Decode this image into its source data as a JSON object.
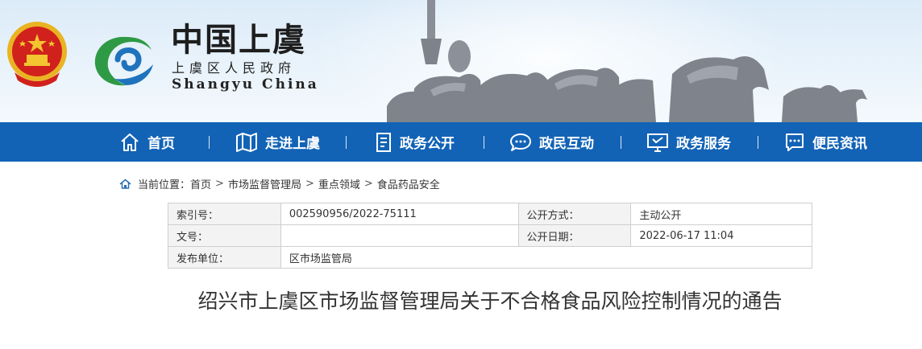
{
  "header": {
    "site_title": "中国上虞",
    "site_subtitle": "上虞区人民政府",
    "site_en": "Shangyu China",
    "brand_blue": "#1263b6",
    "brand_green": "#2f9a45"
  },
  "nav": {
    "items": [
      {
        "label": "首页",
        "icon": "home-icon"
      },
      {
        "label": "走进上虞",
        "icon": "map-icon"
      },
      {
        "label": "政务公开",
        "icon": "document-icon"
      },
      {
        "label": "政民互动",
        "icon": "chat-icon"
      },
      {
        "label": "政务服务",
        "icon": "monitor-icon"
      },
      {
        "label": "便民资讯",
        "icon": "message-icon"
      }
    ]
  },
  "breadcrumb": {
    "prefix": "当前位置：",
    "items": [
      "首页",
      "市场监督管理局",
      "重点领域",
      "食品药品安全"
    ],
    "separator": ">"
  },
  "meta": {
    "index_label": "索引号：",
    "index_value": "002590956/2022-75111",
    "method_label": "公开方式：",
    "method_value": "主动公开",
    "doc_label": "文号：",
    "doc_value": "",
    "date_label": "公开日期：",
    "date_value": "2022-06-17 11:04",
    "publisher_label": "发布单位：",
    "publisher_value": "区市场监管局"
  },
  "article": {
    "title": "绍兴市上虞区市场监督管理局关于不合格食品风险控制情况的通告"
  }
}
